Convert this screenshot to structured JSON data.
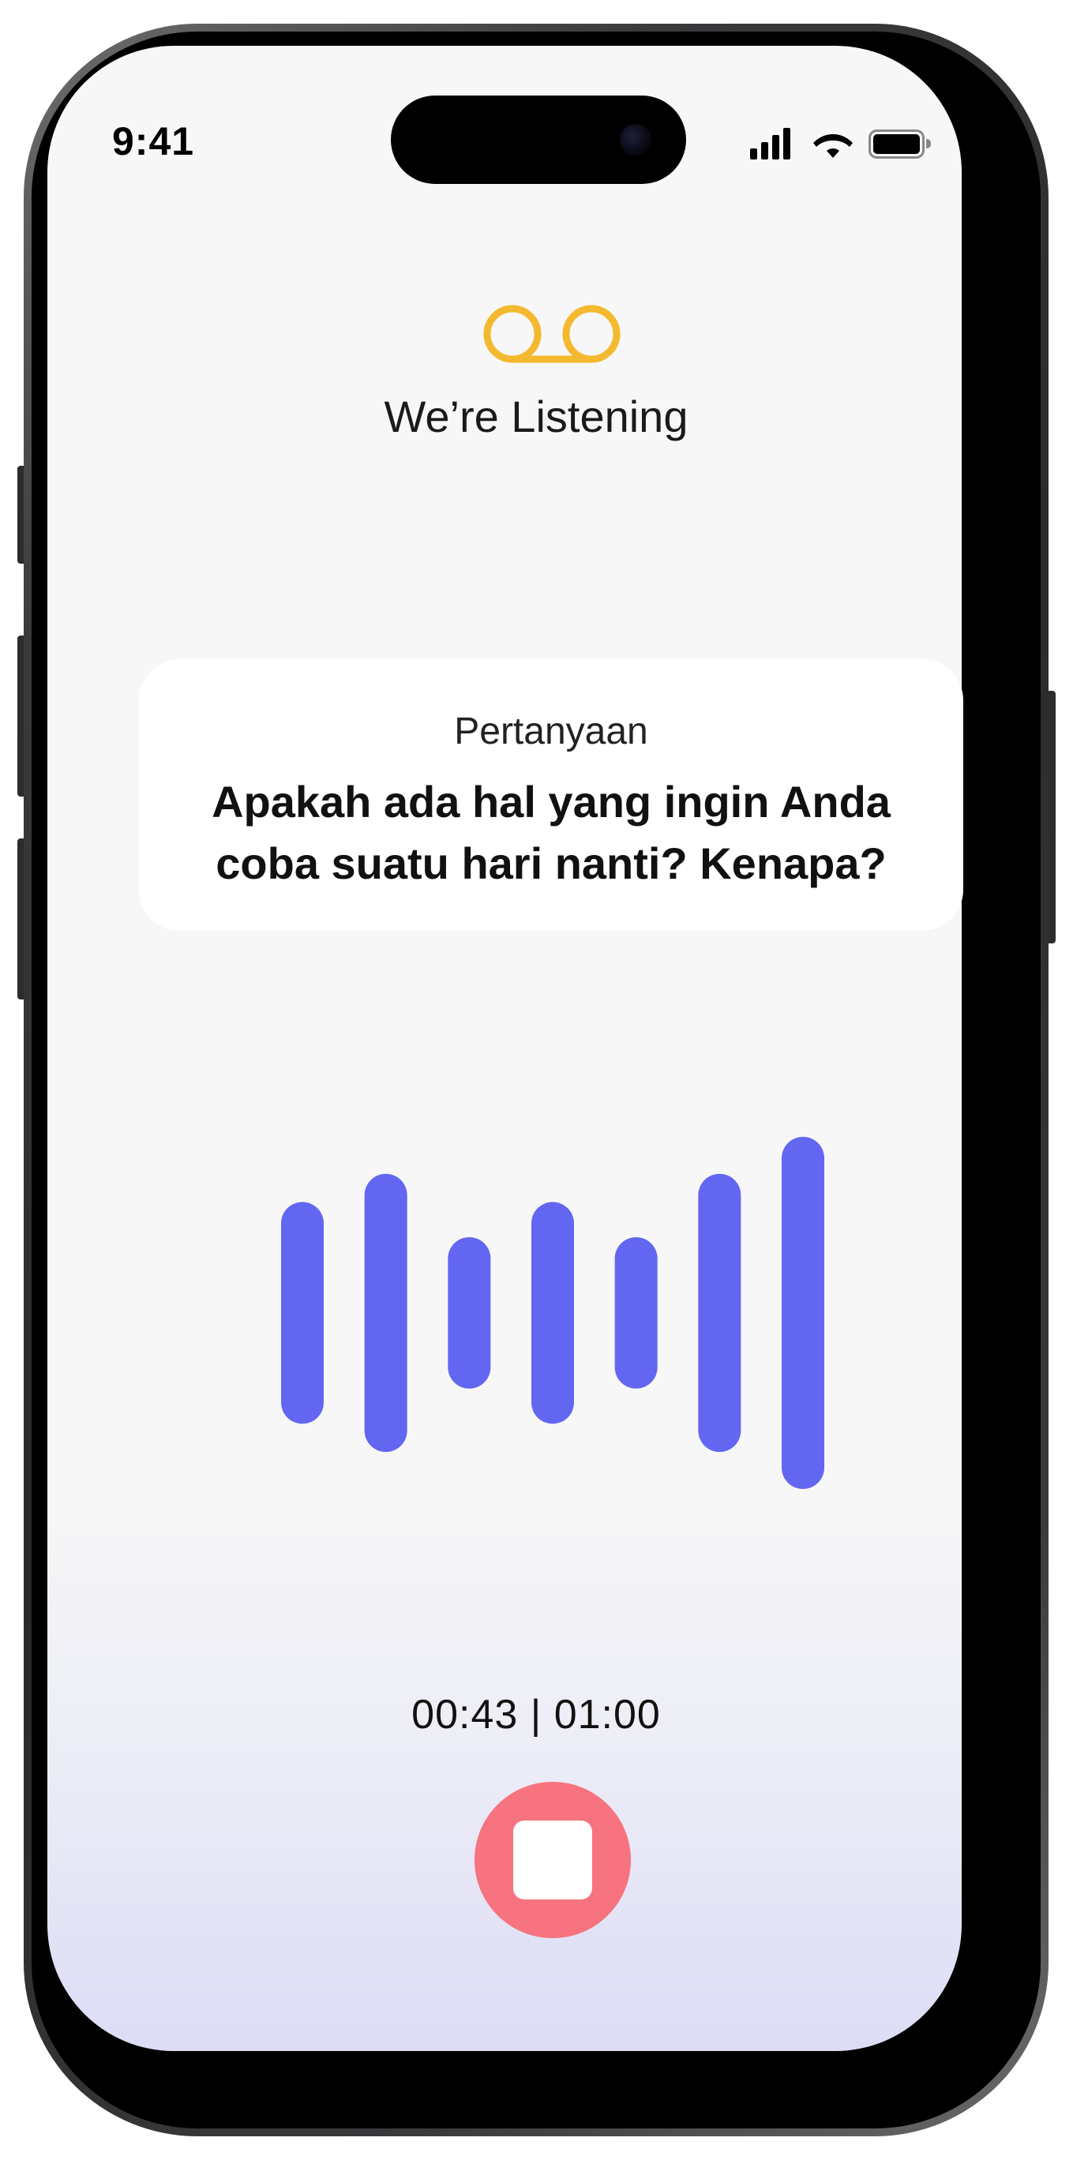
{
  "status_bar": {
    "time": "9:41",
    "icons": [
      "cellular-signal-icon",
      "wifi-icon",
      "battery-icon"
    ]
  },
  "header": {
    "icon": "voicemail-icon",
    "title": "We’re Listening"
  },
  "question": {
    "label": "Pertanyaan",
    "text": "Apakah ada hal yang ingin Anda coba suatu hari nanti? Kenapa?"
  },
  "waveform": {
    "levels": [
      0.63,
      0.79,
      0.43,
      0.63,
      0.43,
      0.79,
      1.0
    ]
  },
  "timer": {
    "text": "00:43 | 01:00"
  },
  "controls": {
    "stop": "stop-icon"
  },
  "colors": {
    "accent_icon": "#f5b92f",
    "waveform": "#6366f1",
    "stop_button": "#f6737f",
    "background": "#f7f7f7",
    "gradient_bottom": "#dcdcf5"
  }
}
